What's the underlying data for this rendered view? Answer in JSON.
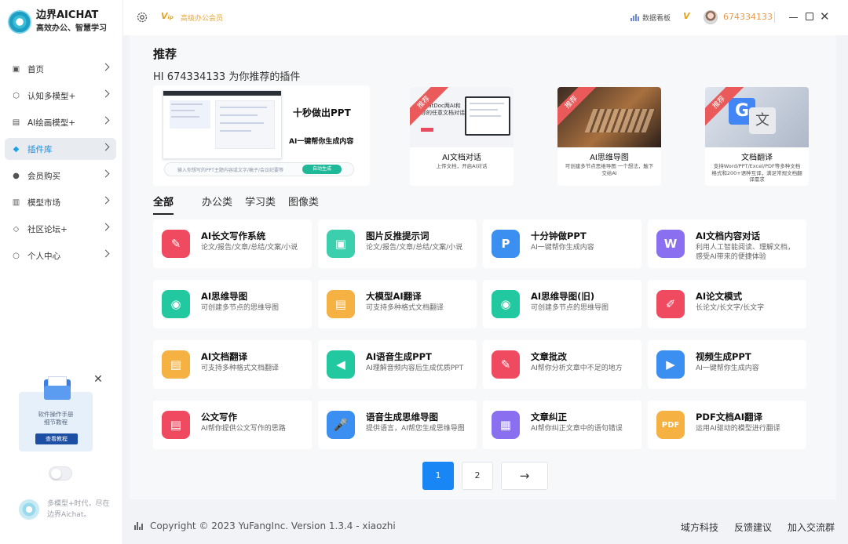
{
  "brand": {
    "name": "边界AICHAT",
    "slogan": "高效办公、智慧学习"
  },
  "sidebar": {
    "items": [
      {
        "label": "首页",
        "icon": "home-icon",
        "active": false
      },
      {
        "label": "认知多模型+",
        "icon": "cube-icon",
        "active": false
      },
      {
        "label": "AI绘画模型+",
        "icon": "image-icon",
        "active": false
      },
      {
        "label": "插件库",
        "icon": "gem-icon",
        "active": true
      },
      {
        "label": "会员购买",
        "icon": "user-icon",
        "active": false
      },
      {
        "label": "模型市场",
        "icon": "store-icon",
        "active": false
      },
      {
        "label": "社区论坛+",
        "icon": "forum-icon",
        "active": false
      },
      {
        "label": "个人中心",
        "icon": "person-icon",
        "active": false
      }
    ],
    "promo": {
      "line1": "软件操作手册",
      "line2": "细节教程",
      "button": "查看教程"
    },
    "footer_text": "多模型+时代，尽在边界Aichat。"
  },
  "topbar": {
    "vip_label": "高级办公会员",
    "dashboard": "数据看板",
    "user_id": "674334133"
  },
  "main": {
    "title": "推荐",
    "subtitle": "HI 674334133 为你推荐的插件",
    "hero": {
      "headline": "十秒做出PPT",
      "subline": "AI一键帮你生成内容",
      "input_placeholder": "输入你想写的PPT主题内容或文字/稿子/会议纪要等",
      "button": "自动生成",
      "shot_title": "Build better, ready",
      "shot_sub": "开始创作你的PPT"
    },
    "recommended": [
      {
        "ribbon": "推荐",
        "title": "AI文档对话",
        "desc": "上传文档，开启AI对话",
        "img_text": "ChatDoc两AI和你的任意文档对话",
        "accent": "#e84a5f"
      },
      {
        "ribbon": "推荐",
        "title": "AI思维导图",
        "desc": "可创建多节点思维导图 一个想法，触下交给AI",
        "accent": "#6b4a3a"
      },
      {
        "ribbon": "推荐",
        "title": "文档翻译",
        "desc": "支持Word/PPT/Excel/PDF等多种文档格式和200+语种互译，满足常规文档翻译需求",
        "accent": "#4285f4"
      }
    ],
    "tabs": [
      "全部",
      "办公类",
      "学习类",
      "图像类"
    ],
    "plugins": [
      {
        "title": "AI长文写作系统",
        "desc": "论文/报告/文章/总结/文案/小说",
        "icon": "edit-icon",
        "color": "#ef4a5f",
        "glyph": "✎"
      },
      {
        "title": "图片反推提示词",
        "desc": "论文/报告/文章/总结/文案/小说",
        "icon": "gallery-icon",
        "color": "#3ccfae",
        "glyph": "▣"
      },
      {
        "title": "十分钟做PPT",
        "desc": "AI一键帮你生成内容",
        "icon": "ppt-icon",
        "color": "#3b8ff0",
        "glyph": "P"
      },
      {
        "title": "AI文档内容对话",
        "desc": "利用人工智能阅读、理解文档，感受AI带来的便捷体验",
        "icon": "word-icon",
        "color": "#8a6ff0",
        "glyph": "W"
      },
      {
        "title": "AI思维导图",
        "desc": "可创建多节点的思维导图",
        "icon": "brain-icon",
        "color": "#22c9a0",
        "glyph": "◉"
      },
      {
        "title": "大模型AI翻译",
        "desc": "可支持多种格式文档翻译",
        "icon": "doc-icon",
        "color": "#f5b142",
        "glyph": "▤"
      },
      {
        "title": "AI思维导图(旧)",
        "desc": "可创建多节点的思维导图",
        "icon": "brain-icon",
        "color": "#22c9a0",
        "glyph": "◉"
      },
      {
        "title": "AI论文模式",
        "desc": "长论文/长文字/长文字",
        "icon": "brush-icon",
        "color": "#ef4a5f",
        "glyph": "✐"
      },
      {
        "title": "AI文档翻译",
        "desc": "可支持多种格式文档翻译",
        "icon": "doc-icon",
        "color": "#f5b142",
        "glyph": "▤"
      },
      {
        "title": "AI语音生成PPT",
        "desc": "AI理解音频内容后生成优质PPT",
        "icon": "audio-icon",
        "color": "#22c9a0",
        "glyph": "◀"
      },
      {
        "title": "文章批改",
        "desc": "AI帮你分析文章中不足的地方",
        "icon": "pencil-icon",
        "color": "#ef4a5f",
        "glyph": "✎"
      },
      {
        "title": "视频生成PPT",
        "desc": "AI一键帮你生成内容",
        "icon": "video-icon",
        "color": "#3b8ff0",
        "glyph": "▶"
      },
      {
        "title": "公文写作",
        "desc": "AI帮你提供公文写作的思路",
        "icon": "doc-icon",
        "color": "#ef4a5f",
        "glyph": "▤"
      },
      {
        "title": "语音生成思维导图",
        "desc": "提供语言，AI帮您生成思维导图",
        "icon": "mic-icon",
        "color": "#3b8ff0",
        "glyph": "🎤"
      },
      {
        "title": "文章纠正",
        "desc": "AI帮你纠正文章中的语句错误",
        "icon": "save-icon",
        "color": "#8a6ff0",
        "glyph": "▦"
      },
      {
        "title": "PDF文档AI翻译",
        "desc": "运用AI驱动的模型进行翻译",
        "icon": "pdf-icon",
        "color": "#f5b142",
        "glyph": "PDF"
      }
    ],
    "pager": {
      "pages": [
        "1",
        "2"
      ],
      "next": "→",
      "current": "1"
    }
  },
  "footer": {
    "copyright": "Copyright © 2023 YuFangInc. Version 1.3.4 - xiaozhi",
    "links": [
      "域方科技",
      "反馈建议",
      "加入交流群"
    ]
  }
}
